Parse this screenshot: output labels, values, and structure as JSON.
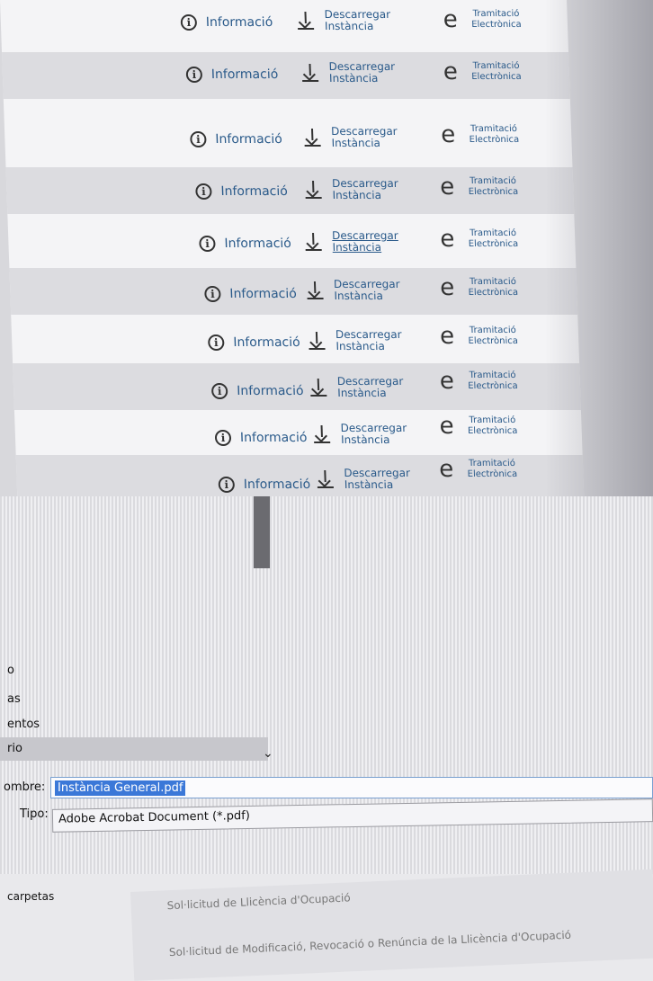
{
  "procedures": {
    "rows": [
      {
        "info": "Informació",
        "download": [
          "Descarregar",
          "Instància"
        ],
        "online": [
          "Tramitació",
          "Electrònica"
        ]
      },
      {
        "info": "Informació",
        "download": [
          "Descarregar",
          "Instància"
        ],
        "online": [
          "Tramitació",
          "Electrònica"
        ]
      },
      {
        "info": "Informació",
        "download": [
          "Descarregar",
          "Instància"
        ],
        "online": [
          "Tramitació",
          "Electrònica"
        ]
      },
      {
        "info": "Informació",
        "download": [
          "Descarregar",
          "Instància"
        ],
        "online": [
          "Tramitació",
          "Electrònica"
        ]
      },
      {
        "info": "Informació",
        "download": [
          "Descarregar",
          "Instància"
        ],
        "online": [
          "Tramitació",
          "Electrònica"
        ]
      },
      {
        "info": "Informació",
        "download": [
          "Descarregar",
          "Instància"
        ],
        "online": [
          "Tramitació",
          "Electrònica"
        ]
      },
      {
        "info": "Informació",
        "download": [
          "Descarregar",
          "Instància"
        ],
        "online": [
          "Tramitació",
          "Electrònica"
        ]
      },
      {
        "info": "Informació",
        "download": [
          "Descarregar",
          "Instància"
        ],
        "online": [
          "Tramitació",
          "Electrònica"
        ]
      },
      {
        "info": "Informació",
        "download": [
          "Descarregar",
          "Instància"
        ],
        "online": [
          "Tramitació",
          "Electrònica"
        ]
      },
      {
        "info": "Informació",
        "download": [
          "Descarregar",
          "Instància"
        ],
        "online": [
          "Tramitació",
          "Electrònica"
        ]
      }
    ],
    "icons": {
      "info": "info-circle-icon",
      "download": "download-arrow-icon",
      "online": "e-icon"
    }
  },
  "save_dialog": {
    "nav_items": [
      "o",
      "as",
      "entos",
      "rio"
    ],
    "name_label": "ombre:",
    "file_name": "Instància General.pdf",
    "type_label": "Tipo:",
    "file_type": "Adobe Acrobat Document (*.pdf)",
    "hide_folders": "carpetas"
  },
  "background_list": {
    "items": [
      "Sol·licitud de Llicència d'Ocupació",
      "Sol·licitud de Modificació, Revocació o Renúncia de la Llicència d'Ocupació"
    ]
  },
  "colors": {
    "link": "#2a5a8a",
    "selection": "#3b78d8"
  }
}
